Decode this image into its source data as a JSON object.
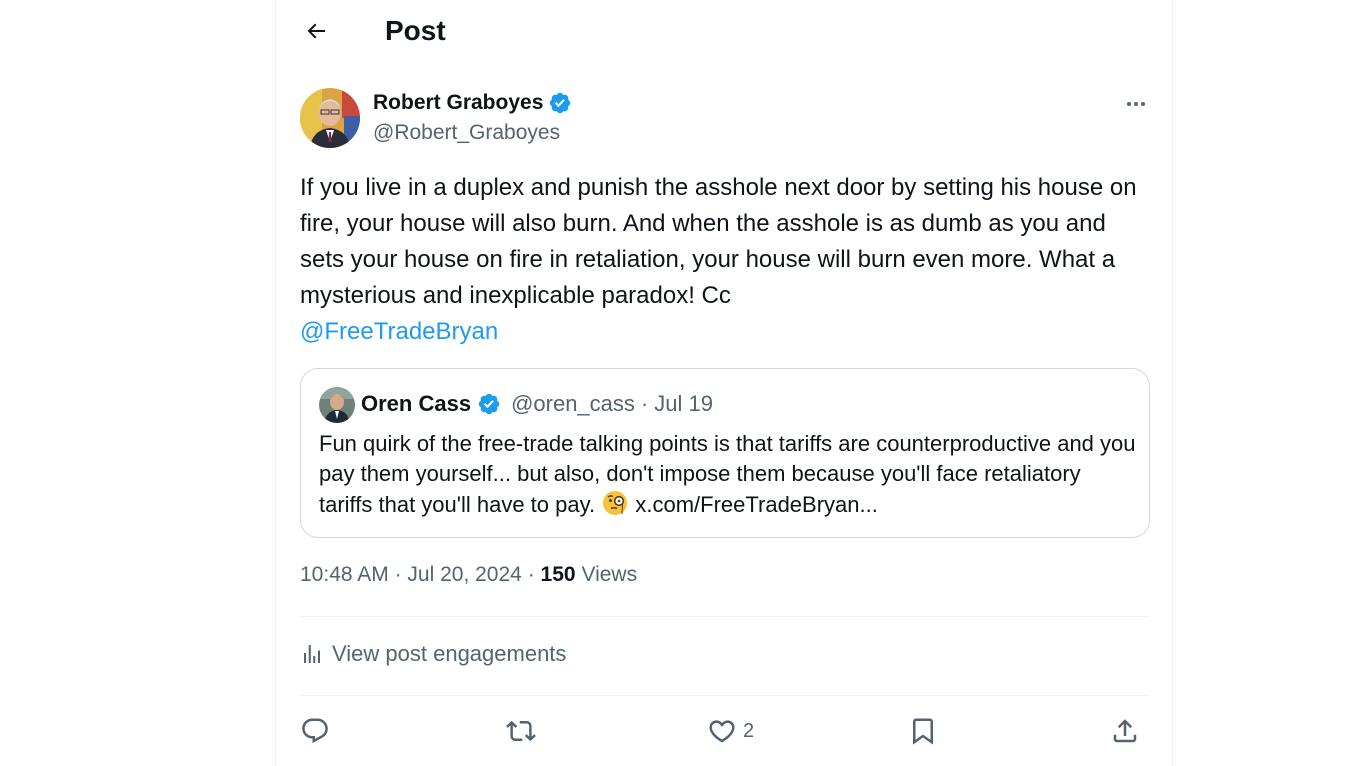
{
  "header": {
    "title": "Post"
  },
  "post": {
    "author_name": "Robert Graboyes",
    "author_handle": "@Robert_Graboyes",
    "text": "If you live in a duplex and punish the asshole next door by setting his house on fire, your house will also burn. And when the asshole is as dumb as you and sets your house on fire in retaliation, your house will burn even more. What a mysterious and inexplicable paradox! Cc",
    "mention": "@FreeTradeBryan",
    "time": "10:48 AM",
    "date": "Jul 20, 2024",
    "views_count": "150",
    "views_label": "Views",
    "meta_sep": "·"
  },
  "quote": {
    "author_name": "Oren Cass",
    "author_handle": "@oren_cass",
    "sep": "·",
    "date": "Jul 19",
    "text": "Fun quirk of the free-trade talking points is that tariffs are counterproductive and you pay them yourself... but also, don't impose them because you'll face retaliatory tariffs that you'll have to pay.",
    "link": "x.com/FreeTradeBryan..."
  },
  "engagements": {
    "label": "View post engagements"
  },
  "actions": {
    "reply_count": "",
    "repost_count": "",
    "like_count": "2"
  },
  "colors": {
    "accent": "#1d9bf0",
    "text": "#0f1419",
    "muted": "#536471",
    "border": "#cfd9de"
  },
  "icons": {
    "back": "arrow-left-icon",
    "verified": "verified-badge-icon",
    "more": "more-icon",
    "engagements": "bar-chart-icon",
    "reply": "reply-icon",
    "repost": "repost-icon",
    "like": "heart-icon",
    "bookmark": "bookmark-icon",
    "share": "share-icon",
    "emoji": "monocle-face-icon"
  }
}
